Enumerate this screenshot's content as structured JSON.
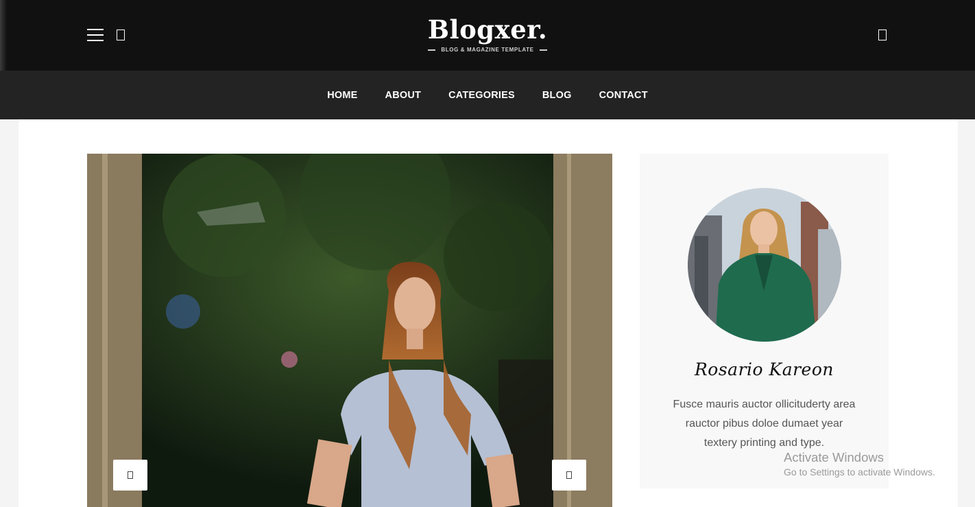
{
  "header": {
    "logo_name": "Blogxer.",
    "logo_tagline": "BLOG & MAGAZINE TEMPLATE"
  },
  "nav": {
    "items": [
      "HOME",
      "ABOUT",
      "CATEGORIES",
      "BLOG",
      "CONTACT"
    ]
  },
  "author": {
    "name": "Rosario Kareon",
    "bio_lines": [
      "Fusce mauris auctor ollicituderty area",
      "rauctor pibus doloe dumaet year",
      "textery printing and type."
    ]
  },
  "watermark": {
    "title": "Activate Windows",
    "subtitle": "Go to Settings to activate Windows."
  },
  "colors": {
    "topbar": "#111111",
    "navbar": "#232323",
    "card": "#f8f8f8"
  }
}
